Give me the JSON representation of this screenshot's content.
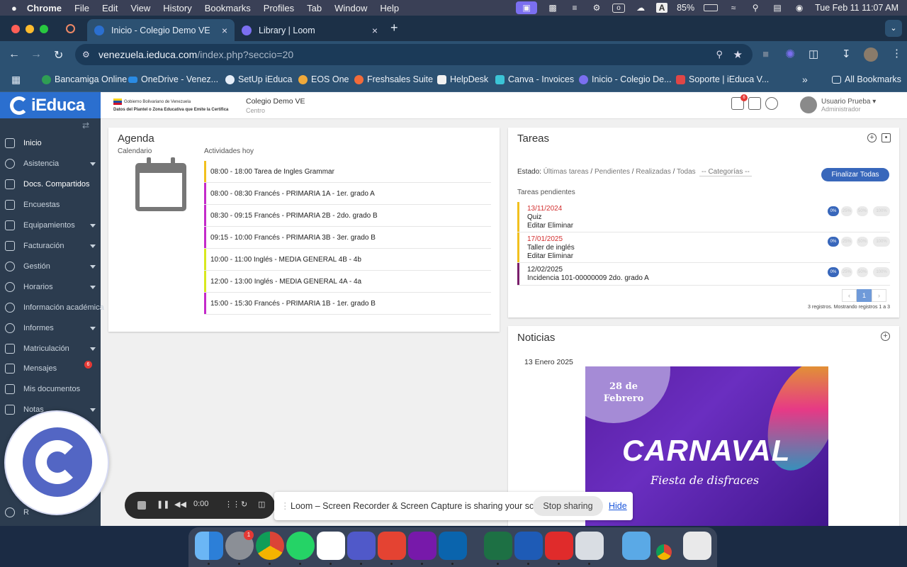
{
  "menubar": {
    "app": "Chrome",
    "items": [
      "File",
      "Edit",
      "View",
      "History",
      "Bookmarks",
      "Profiles",
      "Tab",
      "Window",
      "Help"
    ],
    "battery": "85%",
    "datetime": "Tue Feb 11  11:07 AM"
  },
  "browser": {
    "tabs": [
      {
        "title": "Inicio - Colegio Demo VE"
      },
      {
        "title": "Library | Loom"
      }
    ],
    "url_host": "venezuela.ieduca.com",
    "url_path": "/index.php?seccio=20",
    "bookmarks": [
      "Bancamiga Online",
      "OneDrive - Venez...",
      "SetUp iEduca",
      "EOS One",
      "Freshsales Suite",
      "HelpDesk",
      "Canva - Invoices",
      "Inicio - Colegio De...",
      "Soporte | iEduca V..."
    ],
    "all_bookmarks": "All Bookmarks"
  },
  "app": {
    "logo": "iEduca",
    "gov_line1": "Gobierno Bolivariano de Venezuela",
    "gov_line2": "Datos del Plantel o Zona Educativa que Emite la Certifica",
    "school": "Colegio Demo VE",
    "school_sub": "Centro",
    "mail_badge": "6",
    "user_name": "Usuario Prueba",
    "user_role": "Administrador"
  },
  "sidebar": {
    "items": [
      {
        "label": "Inicio"
      },
      {
        "label": "Asistencia"
      },
      {
        "label": "Docs. Compartidos"
      },
      {
        "label": "Encuestas"
      },
      {
        "label": "Equipamientos"
      },
      {
        "label": "Facturación"
      },
      {
        "label": "Gestión"
      },
      {
        "label": "Horarios"
      },
      {
        "label": "Información académica"
      },
      {
        "label": "Informes"
      },
      {
        "label": "Matriculación"
      },
      {
        "label": "Mensajes",
        "badge": "6"
      },
      {
        "label": "Mis documentos"
      },
      {
        "label": "Notas"
      },
      {
        "label": "R"
      }
    ]
  },
  "agenda": {
    "title": "Agenda",
    "calendar_label": "Calendario",
    "today_label": "Actividades hoy",
    "activities": [
      {
        "text": "08:00 - 18:00 Tarea de Ingles Grammar",
        "color": "#f2c01e"
      },
      {
        "text": "08:00 - 08:30 Francés - PRIMARIA 1A - 1er. grado A",
        "color": "#c42bc9"
      },
      {
        "text": "08:30 - 09:15 Francés - PRIMARIA 2B - 2do. grado B",
        "color": "#c42bc9"
      },
      {
        "text": "09:15 - 10:00 Francés - PRIMARIA 3B - 3er. grado B",
        "color": "#c42bc9"
      },
      {
        "text": "10:00 - 11:00 Inglés - MEDIA GENERAL 4B - 4b",
        "color": "#d8e81f"
      },
      {
        "text": "12:00 - 13:00 Inglés - MEDIA GENERAL 4A - 4a",
        "color": "#d8e81f"
      },
      {
        "text": "15:00 - 15:30 Francés - PRIMARIA 1B - 1er. grado B",
        "color": "#c42bc9"
      }
    ]
  },
  "tareas": {
    "title": "Tareas",
    "estado_label": "Estado:",
    "filters": [
      "Últimas tareas",
      "Pendientes",
      "Realizadas",
      "Todas"
    ],
    "categorias": "-- Categorías --",
    "finalizar": "Finalizar Todas",
    "pending_label": "Tareas pendientes",
    "tasks": [
      {
        "date": "13/11/2024",
        "name": "Quiz",
        "actions": "Editar Eliminar",
        "overdue": true,
        "color": "#f2c01e"
      },
      {
        "date": "17/01/2025",
        "name": "Taller de inglés",
        "actions": "Editar Eliminar",
        "overdue": true,
        "color": "#f2c01e"
      },
      {
        "date": "12/02/2025",
        "name": "Incidencia 101-00000009 2do. grado A",
        "actions": "",
        "overdue": false,
        "color": "#7a1f6b"
      }
    ],
    "pct_labels": [
      "0%",
      "25%",
      "50%",
      "100%"
    ],
    "page": "1",
    "registros": "3 registros. Mostrando registros 1 a 3"
  },
  "noticias": {
    "title": "Noticias",
    "date": "13 Enero 2025",
    "poster_date": "28 de Febrero",
    "poster_title": "CARNAVAL",
    "poster_sub": "Fiesta de disfraces"
  },
  "loom": {
    "timer": "0:00",
    "message": "Loom – Screen Recorder & Screen Capture is sharing your screen.",
    "stop": "Stop sharing",
    "hide": "Hide"
  },
  "dock": {
    "settings_badge": "1"
  }
}
